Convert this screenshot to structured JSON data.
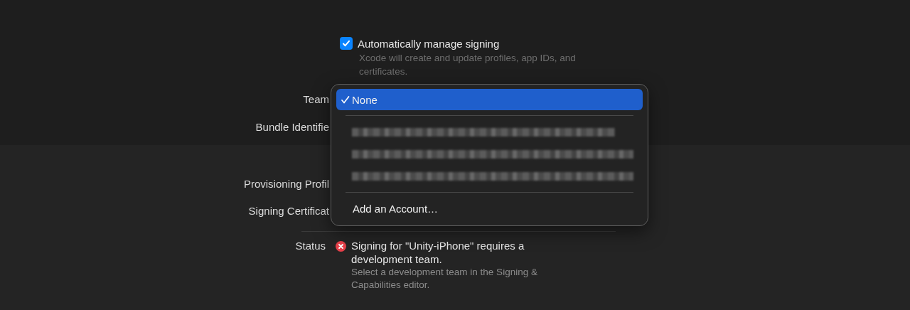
{
  "signing": {
    "auto_manage": {
      "label": "Automatically manage signing",
      "checked": true,
      "description": "Xcode will create and update profiles, app IDs, and certificates."
    },
    "rows_top": [
      {
        "label": "Team"
      },
      {
        "label": "Bundle Identifie"
      }
    ],
    "rows_bottom": [
      {
        "label": "Provisioning Profil"
      },
      {
        "label": "Signing Certificat"
      }
    ],
    "status": {
      "label": "Status",
      "message": "Signing for \"Unity-iPhone\" requires a development team.",
      "detail": "Select a development team in the Signing & Capabilities editor."
    }
  },
  "team_menu": {
    "items": [
      {
        "kind": "item",
        "label": "None",
        "selected": true
      },
      {
        "kind": "separator"
      },
      {
        "kind": "redacted"
      },
      {
        "kind": "redacted"
      },
      {
        "kind": "redacted"
      },
      {
        "kind": "separator"
      },
      {
        "kind": "item",
        "label": "Add an Account…",
        "selected": false
      }
    ]
  }
}
